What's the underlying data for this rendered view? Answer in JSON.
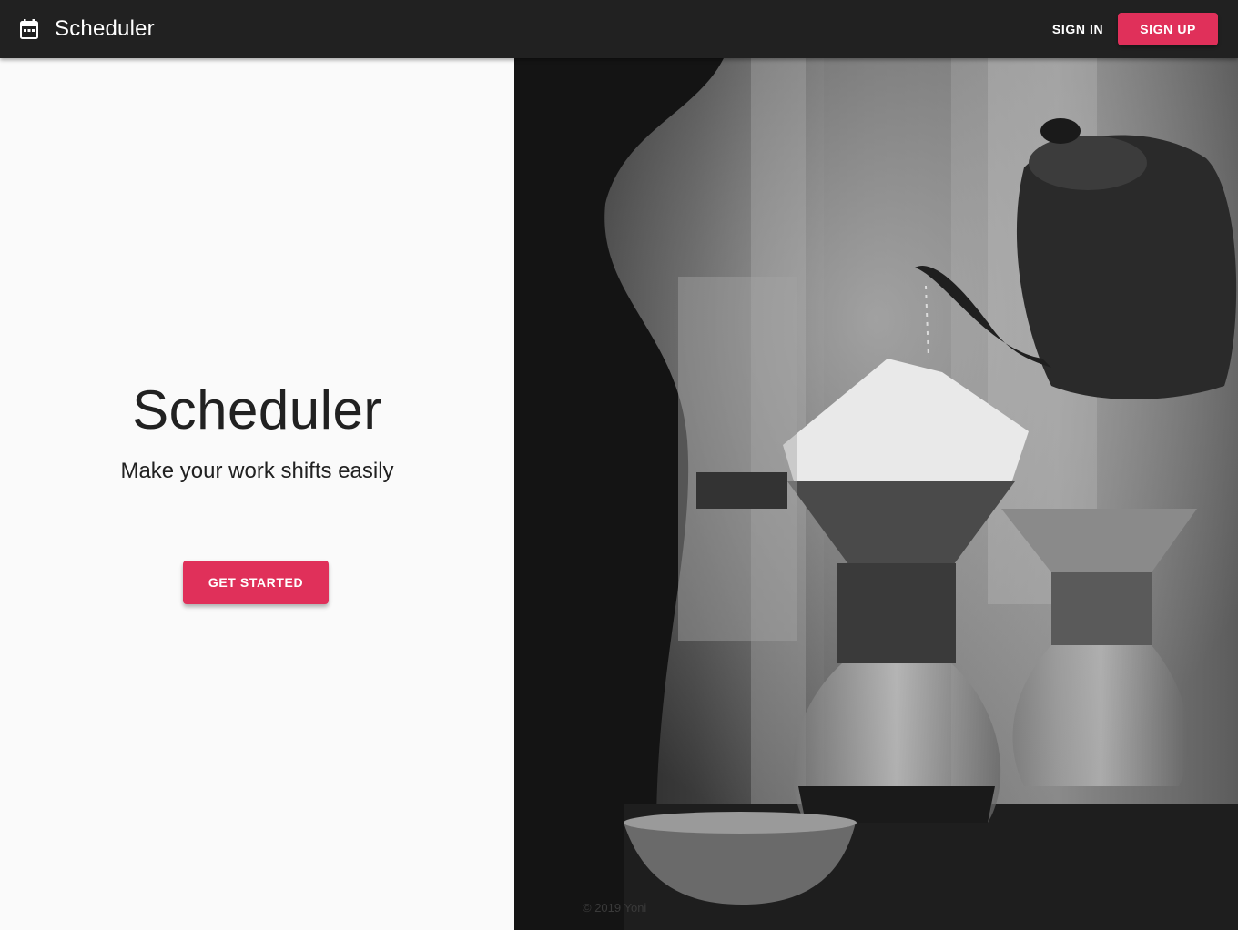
{
  "appbar": {
    "title": "Scheduler",
    "icon": "calendar-icon",
    "sign_in_label": "SIGN IN",
    "sign_up_label": "SIGN UP"
  },
  "hero": {
    "title": "Scheduler",
    "subtitle": "Make your work shifts easily",
    "cta_label": "GET STARTED"
  },
  "image_panel": {
    "description_icon": "coffee-pour-over-photo",
    "copyright": "© 2019 Yoni"
  },
  "colors": {
    "appbar": "#212121",
    "accent": "#e0305a",
    "background": "#fafafa"
  }
}
